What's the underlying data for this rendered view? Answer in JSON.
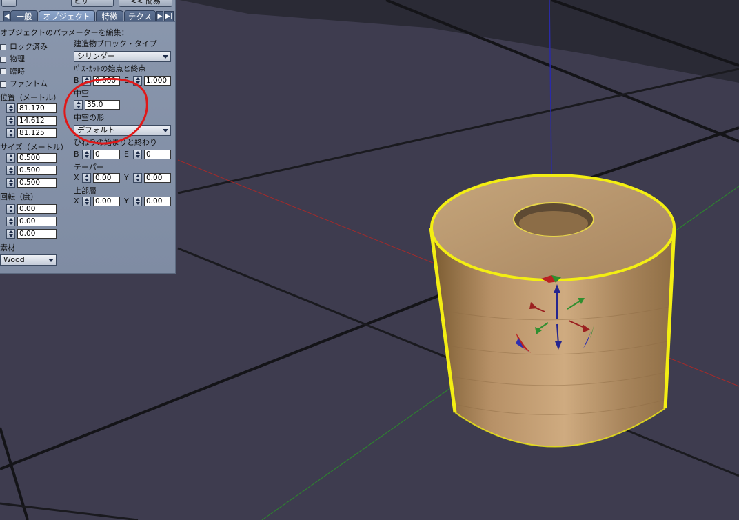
{
  "toolbar": {
    "top_dropdown_value": "ヒザ",
    "less_button": "<< 簡易"
  },
  "tabs": [
    {
      "label": "一般"
    },
    {
      "label": "オブジェクト"
    },
    {
      "label": "特徴"
    },
    {
      "label": "テクス"
    }
  ],
  "panel": {
    "header": "オブジェクトのパラメーターを編集：",
    "flags": [
      "ロック済み",
      "物理",
      "臨時",
      "ファントム"
    ],
    "position": {
      "label": "位置（メートル）",
      "x": "81.170",
      "y": "14.612",
      "z": "81.125"
    },
    "size": {
      "label": "サイズ（メートル）",
      "x": "0.500",
      "y": "0.500",
      "z": "0.500"
    },
    "rotation": {
      "label": "回転（度）",
      "x": "0.00",
      "y": "0.00",
      "z": "0.00"
    },
    "material": {
      "label": "素材",
      "value": "Wood"
    },
    "block_type": {
      "label": "建造物ブロック・タイプ",
      "value": "シリンダー"
    },
    "path_cut": {
      "label": "ﾊﾟｽ･ｶｯﾄの始点と終点",
      "b_label": "B",
      "b_value": "0.000",
      "e_label": "E",
      "e_value": "1.000"
    },
    "hollow": {
      "label": "中空",
      "value": "35.0"
    },
    "hollow_shape": {
      "label": "中空の形",
      "value": "デフォルト"
    },
    "twist": {
      "label": "ひねりの始まりと終わり",
      "b_label": "B",
      "b_value": "0",
      "e_label": "E",
      "e_value": "0"
    },
    "taper": {
      "label": "テーパー",
      "x_label": "X",
      "x_value": "0.00",
      "y_label": "Y",
      "y_value": "0.00"
    },
    "top_shear": {
      "label": "上部層",
      "x_label": "X",
      "x_value": "0.00",
      "y_label": "Y",
      "y_value": "0.00"
    }
  },
  "icons": {
    "tab_prev": "◀",
    "tab_next": "▶",
    "tab_end": "▶|"
  },
  "colors": {
    "panel_bg": "#8a97ad",
    "ground": "#3e3c4f",
    "selection_highlight": "#f3ee13",
    "annotation": "#e01818"
  }
}
